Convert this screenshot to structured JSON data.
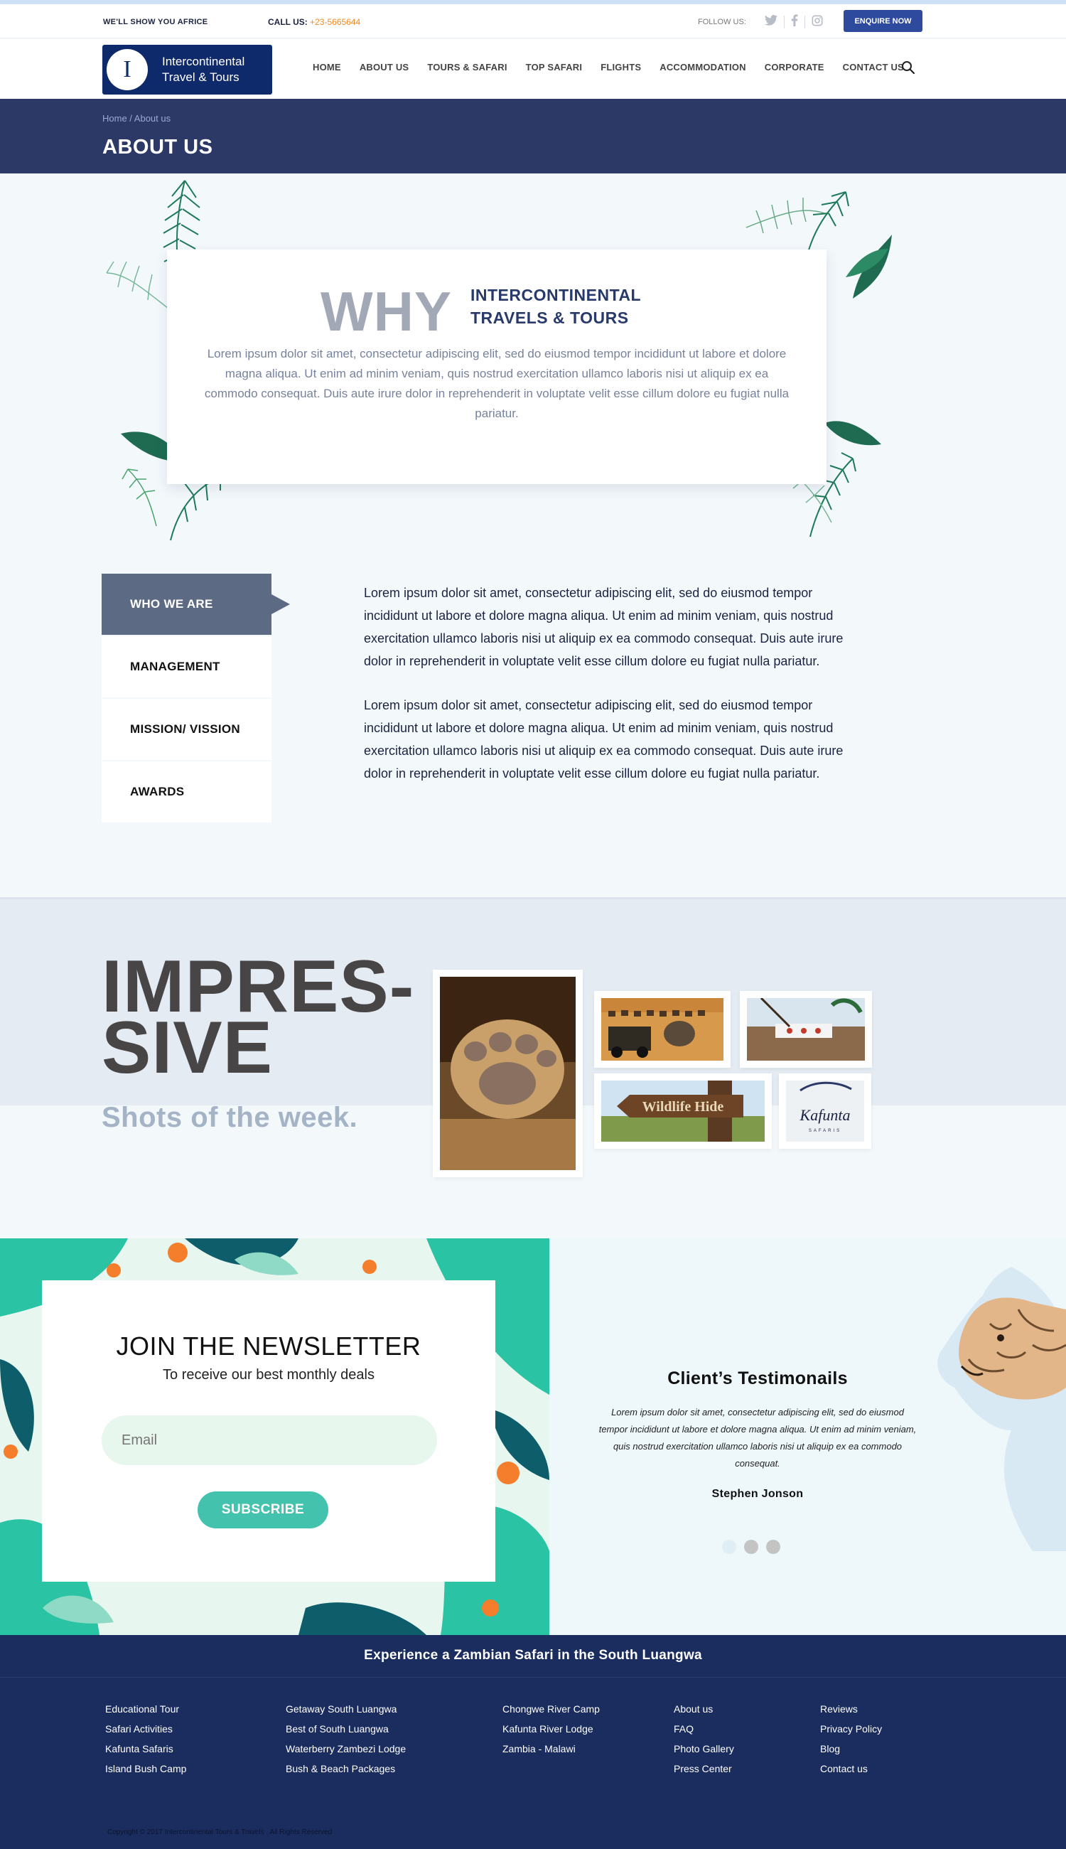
{
  "topbar": {
    "tagline": "WE'LL SHOW YOU AFRICE",
    "call_label": "CALL US:",
    "phone": "+23-5665644",
    "follow_label": "FOLLOW US:",
    "social_icons": [
      "twitter-icon",
      "facebook-icon",
      "instagram-icon"
    ],
    "enquire_label": "ENQUIRE NOW"
  },
  "logo": {
    "monogram": "I",
    "line1": "Intercontinental",
    "line2": "Travel & Tours"
  },
  "nav": {
    "items": [
      "HOME",
      "ABOUT US",
      "TOURS & SAFARI",
      "TOP SAFARI",
      "FLIGHTS",
      "ACCOMMODATION",
      "CORPORATE",
      "CONTACT US"
    ],
    "search_icon": "search-icon"
  },
  "page_header": {
    "breadcrumb": "Home / About us",
    "title": "ABOUT US"
  },
  "why": {
    "big": "WHY",
    "line1": "INTERCONTINENTAL",
    "line2": "TRAVELS & TOURS",
    "text": "Lorem ipsum dolor sit amet, consectetur adipiscing elit, sed do eiusmod tempor incididunt ut labore et dolore magna aliqua. Ut enim ad minim veniam, quis nostrud exercitation ullamco laboris nisi ut aliquip ex ea commodo consequat. Duis aute irure dolor in reprehenderit in voluptate velit esse cillum dolore eu fugiat nulla pariatur."
  },
  "tabs": {
    "items": [
      "WHO WE ARE",
      "MANAGEMENT",
      "MISSION/ VISSION",
      "AWARDS"
    ],
    "active": "WHO WE ARE",
    "paragraphs": [
      "Lorem ipsum dolor sit amet, consectetur adipiscing elit, sed do eiusmod tempor incididunt ut labore et dolore magna aliqua. Ut enim ad minim veniam, quis nostrud exercitation ullamco laboris nisi ut aliquip ex ea commodo consequat. Duis aute irure dolor in reprehenderit in voluptate velit esse cillum dolore eu fugiat nulla pariatur.",
      "Lorem ipsum dolor sit amet, consectetur adipiscing elit, sed do eiusmod tempor incididunt ut labore et dolore magna aliqua. Ut enim ad minim veniam, quis nostrud exercitation ullamco laboris nisi ut aliquip ex ea commodo consequat. Duis aute irure dolor in reprehenderit in voluptate velit esse cillum dolore eu fugiat nulla pariatur."
    ]
  },
  "impressive": {
    "line1": "IMPRES-",
    "line2": "SIVE",
    "subtitle": "Shots of the week.",
    "photos": {
      "sign_text": "Wildlife Hide",
      "brand_text": "Kafunta",
      "brand_sub": "SAFARIS"
    }
  },
  "newsletter": {
    "title": "JOIN THE NEWSLETTER",
    "subtitle": "To receive our best monthly deals",
    "email_placeholder": "Email",
    "button": "SUBSCRIBE"
  },
  "testimonials": {
    "title": "Client’s Testimonails",
    "text": "Lorem ipsum dolor sit amet, consectetur adipiscing elit, sed do eiusmod tempor incididunt ut labore et dolore magna aliqua. Ut enim ad minim veniam, quis nostrud exercitation ullamco laboris nisi ut aliquip ex ea commodo consequat.",
    "author": "Stephen Jonson",
    "dots": 3,
    "active_dot": 1
  },
  "footer": {
    "heading": "Experience a Zambian Safari in the South Luangwa",
    "columns": [
      [
        "Educational Tour",
        "Safari Activities",
        "Kafunta Safaris",
        "Island Bush Camp"
      ],
      [
        "Getaway South Luangwa",
        "Best of South Luangwa",
        "Waterberry Zambezi Lodge",
        "Bush & Beach Packages"
      ],
      [
        "Chongwe River Camp",
        "Kafunta River Lodge",
        "Zambia - Malawi"
      ],
      [
        "About us",
        "FAQ",
        "Photo Gallery",
        "Press Center"
      ],
      [
        "Reviews",
        "Privacy Policy",
        "Blog",
        "Contact us"
      ]
    ],
    "copyright": "Copyright © 2017  Intercontinental Tours  & Travels . All Rights Reserved"
  },
  "colors": {
    "brand_navy": "#0f2a6b",
    "header_band": "#2c3866",
    "phone_orange": "#f08a24",
    "enquire_blue": "#2e4a9e",
    "subscribe_teal": "#43c3ad",
    "footer_navy": "#1b2d5e",
    "tab_active": "#5d6a83"
  }
}
